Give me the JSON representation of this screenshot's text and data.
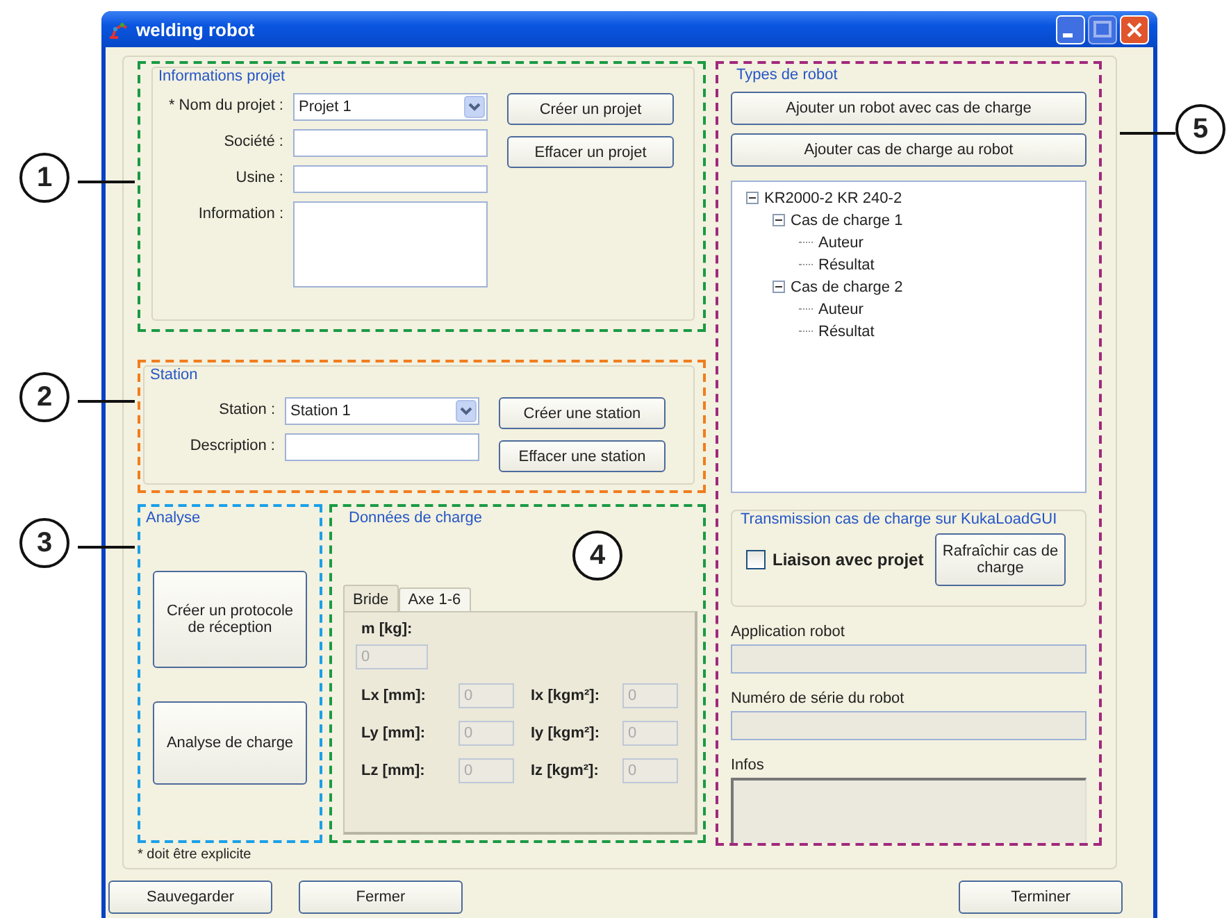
{
  "window": {
    "title": "welding robot"
  },
  "callouts": [
    {
      "label": "1"
    },
    {
      "label": "2"
    },
    {
      "label": "3"
    },
    {
      "label": "4"
    },
    {
      "label": "5"
    }
  ],
  "project": {
    "title": "Informations projet",
    "fields": [
      {
        "label": "* Nom du projet :",
        "kind": "dropdown",
        "value": "Projet 1"
      },
      {
        "label": "Société :",
        "kind": "text"
      },
      {
        "label": "Usine :",
        "kind": "text"
      },
      {
        "label": "Information :",
        "kind": "textarea"
      }
    ],
    "buttons": [
      "Créer un projet",
      "Effacer un projet"
    ]
  },
  "station": {
    "title": "Station",
    "fields": [
      {
        "label": "Station :",
        "kind": "dropdown",
        "value": "Station 1"
      },
      {
        "label": "Description :",
        "kind": "text"
      }
    ],
    "buttons": [
      "Créer une station",
      "Effacer une station"
    ]
  },
  "analysis": {
    "title": "Analyse",
    "buttons": [
      "Créer un protocole de réception",
      "Analyse de charge"
    ]
  },
  "load_data": {
    "title": "Données de charge",
    "tabs": [
      {
        "label": "Bride",
        "selected": true
      },
      {
        "label": "Axe 1-6",
        "selected": false
      }
    ],
    "mass": {
      "label": "m [kg]:",
      "value": "0"
    },
    "rows": [
      {
        "left_label": "Lx [mm]:",
        "left_value": "0",
        "right_label": "Ix [kgm²]:",
        "right_value": "0"
      },
      {
        "left_label": "Ly [mm]:",
        "left_value": "0",
        "right_label": "Iy [kgm²]:",
        "right_value": "0"
      },
      {
        "left_label": "Lz [mm]:",
        "left_value": "0",
        "right_label": "Iz [kgm²]:",
        "right_value": "0"
      }
    ]
  },
  "required_note": "* doit être explicite",
  "robot_types": {
    "title": "Types de robot",
    "buttons": [
      "Ajouter un robot avec cas de charge",
      "Ajouter cas de charge au robot"
    ],
    "tree": [
      {
        "label": "KR2000-2 KR 240-2",
        "expanded": true,
        "children": [
          {
            "label": "Cas de charge 1",
            "expanded": true,
            "children": [
              {
                "label": "Auteur"
              },
              {
                "label": "Résultat"
              }
            ]
          },
          {
            "label": "Cas de charge 2",
            "expanded": true,
            "children": [
              {
                "label": "Auteur"
              },
              {
                "label": "Résultat"
              }
            ]
          }
        ]
      }
    ],
    "transmission": {
      "title": "Transmission cas de charge sur KukaLoadGUI",
      "checkbox": {
        "label": "Liaison avec projet",
        "checked": false
      },
      "button": "Rafraîchir cas de charge"
    },
    "info_fields": [
      {
        "label": "Application robot",
        "kind": "line"
      },
      {
        "label": "Numéro de série du robot",
        "kind": "line"
      },
      {
        "label": "Infos",
        "kind": "area"
      }
    ]
  },
  "footer": {
    "left_buttons": [
      "Sauvegarder",
      "Fermer"
    ],
    "right_buttons": [
      "Terminer"
    ]
  }
}
